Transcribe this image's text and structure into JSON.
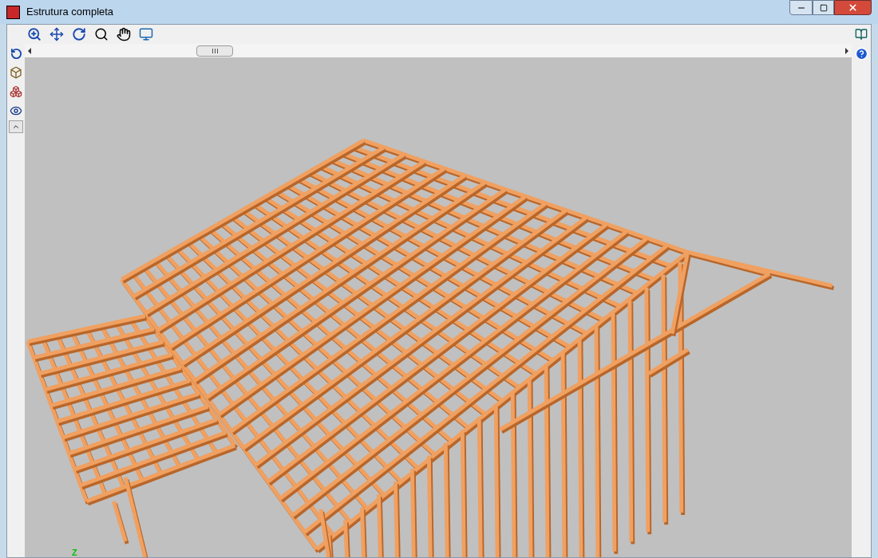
{
  "window": {
    "title": "Estrutura completa"
  },
  "viewport": {
    "axis_label": "Z"
  }
}
